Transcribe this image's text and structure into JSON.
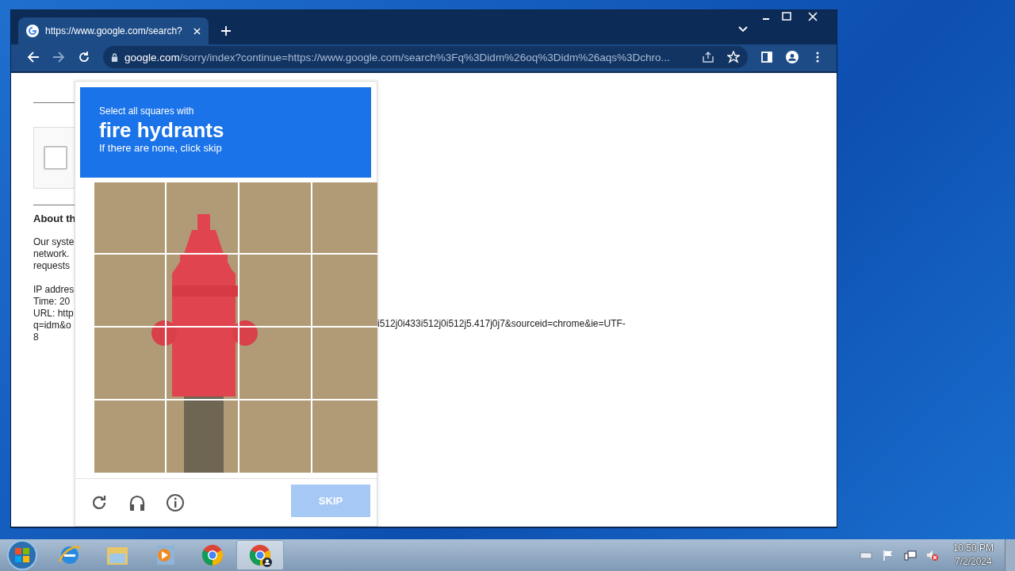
{
  "browser": {
    "tab": {
      "title": "https://www.google.com/search?",
      "selected": true
    },
    "address": {
      "domain": "google.com",
      "path": "/sorry/index?continue=https://www.google.com/search%3Fq%3Didm%26oq%3Didm%26aqs%3Dchro..."
    }
  },
  "page": {
    "checkbox": {
      "checked": false
    },
    "heading": "About th",
    "paragraph_1": [
      "Our syste",
      "network.",
      "requests"
    ],
    "paragraph_2": [
      "IP addres",
      "Time: 20",
      "URL: http",
      "q=idm&o",
      "8"
    ],
    "url_tail": "i512j0i433i512j0i512j5.417j0j7&sourceid=chrome&ie=UTF-"
  },
  "captcha": {
    "instruction": "Select all squares with",
    "target": "fire hydrants",
    "hint": "If there are none, click skip",
    "skip_button": {
      "label": "SKIP",
      "disabled": true
    }
  },
  "taskbar": {
    "apps": [
      {
        "kind": "ie",
        "active": false
      },
      {
        "kind": "folder",
        "active": false
      },
      {
        "kind": "media",
        "active": false
      },
      {
        "kind": "chrome",
        "active": false
      },
      {
        "kind": "chrome-profile",
        "active": true
      }
    ],
    "clock": {
      "time": "10:50 PM",
      "date": "7/2/2024"
    }
  }
}
